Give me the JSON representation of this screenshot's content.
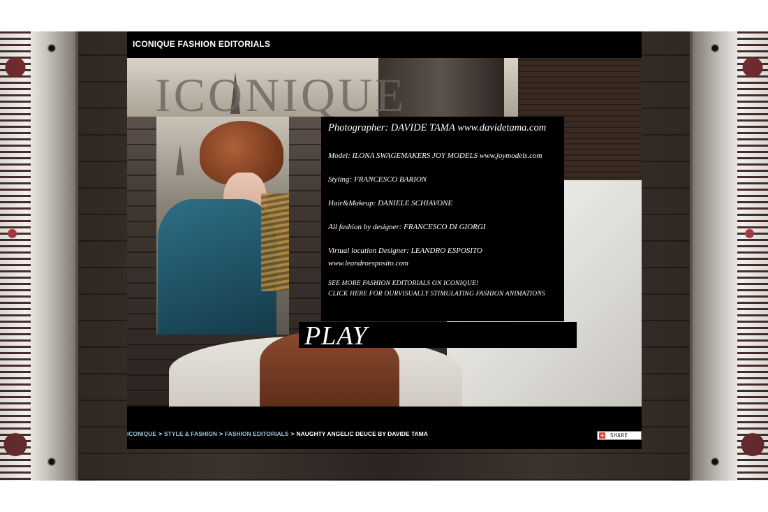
{
  "header": {
    "site_title": "ICONIQUE FASHION EDITORIALS"
  },
  "hero": {
    "brand_watermark": "ICONIQUE"
  },
  "credits": {
    "photographer": "Photographer: DAVIDE TAMA www.davidetama.com",
    "model": "Model: ILONA SWAGEMAKERS JOY MODELS www.joymodels.com",
    "styling": "Styling: FRANCESCO BARION",
    "hair_makeup": "Hair&Makeup: DANIELE SCHIAVONE",
    "fashion": "All fashion by designer: FRANCESCO DI GIORGI",
    "location": "Virtual location Designer: LEANDRO ESPOSITO",
    "location_url": "www.leandroesposito.com",
    "more_link": "SEE MORE FASHION EDITORIALS ON ICONIQUE!",
    "animations_link": "CLICK HERE FOR OURVISUALLY STIMULATING FASHION ANIMATIONS"
  },
  "play": {
    "label": "PLAY"
  },
  "breadcrumb": {
    "items": [
      "ICONIQUE",
      "STYLE & FASHION",
      "FASHION EDITORIALS"
    ],
    "separator": ">",
    "current": "NAUGHTY ANGELIC DEUCE BY DAVIDE TAMA"
  },
  "share": {
    "label": "SHARE",
    "icon": "plus-icon"
  }
}
